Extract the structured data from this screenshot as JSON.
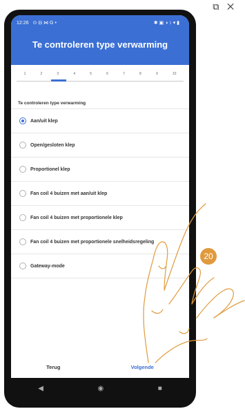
{
  "status": {
    "time": "12:26",
    "left_icons": "⊙ ⊟ ⋈ G •",
    "right_icons": "✱ ▣ ◑ ↕ ▾ ▮"
  },
  "header": {
    "title": "Te controleren type verwarming"
  },
  "corner": {
    "icons": "⧉ ✕"
  },
  "steps": {
    "numbers": [
      "1",
      "2",
      "3",
      "4",
      "5",
      "6",
      "7",
      "8",
      "9",
      "10"
    ],
    "active": 3
  },
  "section": {
    "label": "Te controleren type verwarming"
  },
  "options": [
    {
      "label": "Aan/uit klep",
      "checked": true
    },
    {
      "label": "Open/gesloten klep",
      "checked": false
    },
    {
      "label": "Proportionel klep",
      "checked": false
    },
    {
      "label": "Fan coil 4 buizen met aan/uit klep",
      "checked": false
    },
    {
      "label": "Fan coil 4 buizen met proportionele klep",
      "checked": false
    },
    {
      "label": "Fan coil 4 buizen met proportionele snelheidsregeling",
      "checked": false
    },
    {
      "label": "Gateway-mode",
      "checked": false
    }
  ],
  "actions": {
    "back": "Terug",
    "next": "Volgende"
  },
  "nav": {
    "back": "◀",
    "home": "◉",
    "recents": "■"
  },
  "badge": {
    "number": "20"
  },
  "colors": {
    "accent": "#3b6fd4",
    "badge": "#e09a3d"
  }
}
